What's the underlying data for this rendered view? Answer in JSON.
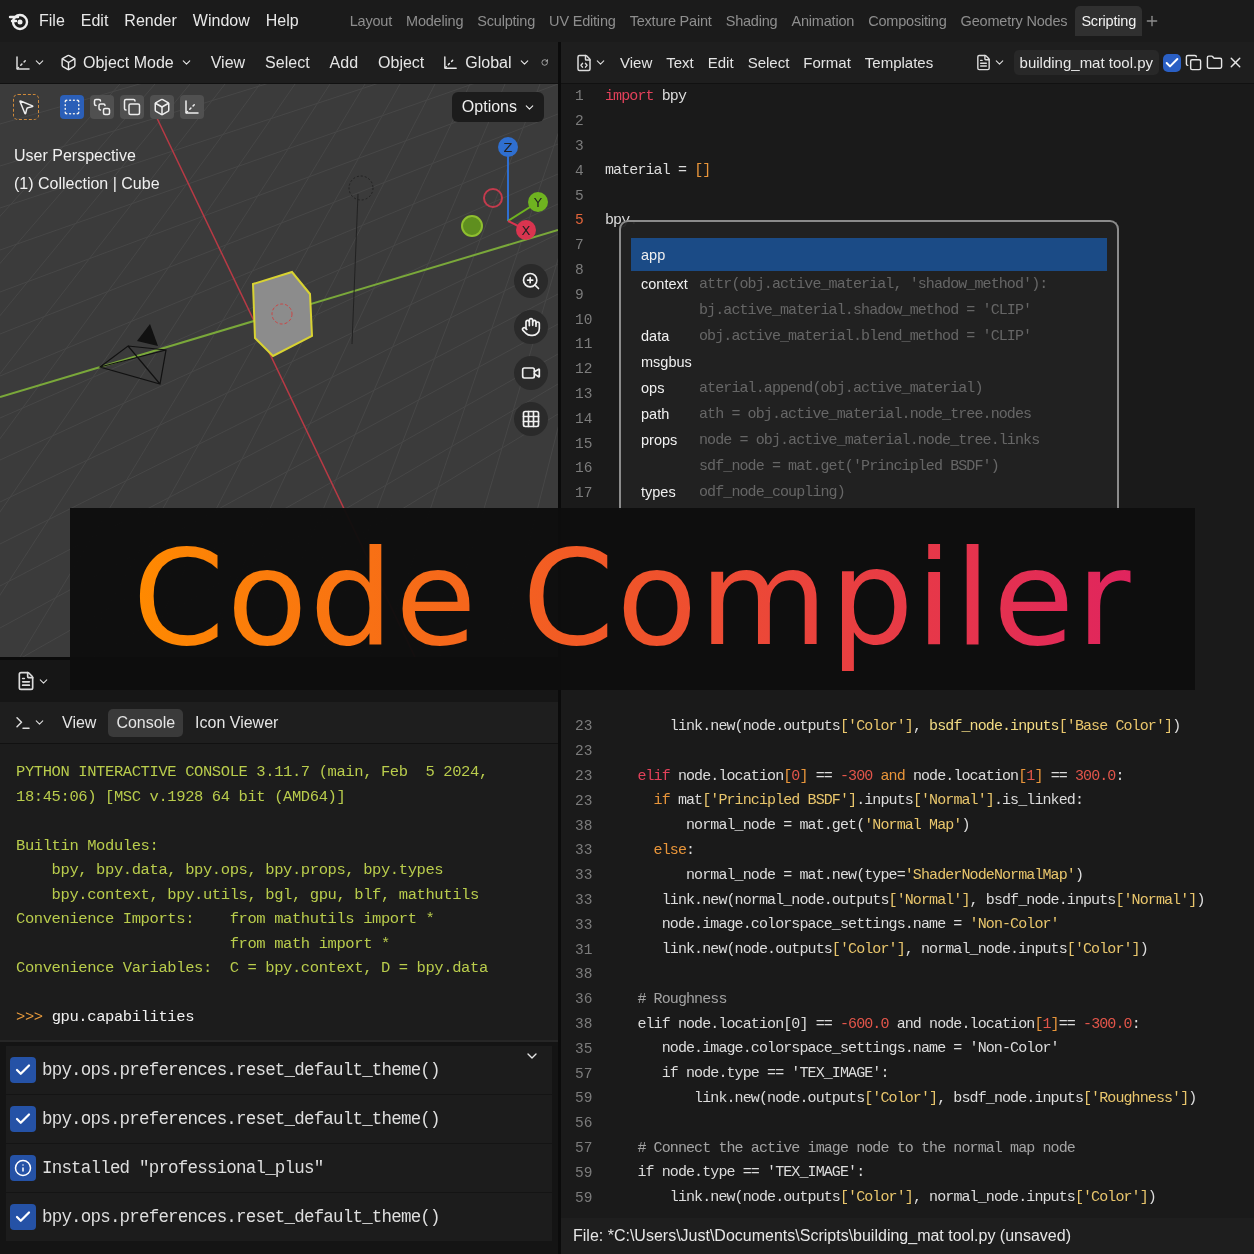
{
  "menu_bar": {
    "items": [
      "File",
      "Edit",
      "Render",
      "Window",
      "Help"
    ],
    "workspaces": [
      {
        "label": "Layout",
        "selected": false
      },
      {
        "label": "Modeling",
        "selected": false
      },
      {
        "label": "Sculpting",
        "selected": false
      },
      {
        "label": "UV Editing",
        "selected": false
      },
      {
        "label": "Texture Paint",
        "selected": false
      },
      {
        "label": "Shading",
        "selected": false
      },
      {
        "label": "Animation",
        "selected": false
      },
      {
        "label": "Compositing",
        "selected": false
      },
      {
        "label": "Geometry Nodes",
        "selected": false
      },
      {
        "label": "Scripting",
        "selected": true
      }
    ]
  },
  "viewport": {
    "mode": "Object Mode",
    "menus": [
      "View",
      "Select",
      "Add",
      "Object"
    ],
    "orientation": "Global",
    "options": "Options",
    "select_modes": [
      {
        "selected": true
      },
      {
        "selected": false
      },
      {
        "selected": false
      },
      {
        "selected": false
      },
      {
        "selected": false
      }
    ],
    "overlay_lines": [
      "User Perspective",
      "(1) Collection | Cube"
    ],
    "gizmo_axes": [
      {
        "label": "Z",
        "color": "#2f6fd0"
      },
      {
        "label": "Y",
        "color": "#6fb320"
      },
      {
        "label": "X",
        "color": "#d9344f"
      }
    ]
  },
  "console": {
    "menus": [
      {
        "label": "View",
        "selected": false
      },
      {
        "label": "Console",
        "selected": true
      },
      {
        "label": "Icon Viewer",
        "selected": false
      }
    ],
    "output_blocks": [
      [
        "PYTHON INTERACTIVE CONSOLE 3.11.7 (main, Feb  5 2024,",
        "18:45:06) [MSC v.1928 64 bit (AMD64)]"
      ],
      [
        "Builtin Modules:",
        "    bpy, bpy.data, bpy.ops, bpy.props, bpy.types",
        "    bpy.context, bpy.utils, bgl, gpu, blf, mathutils",
        "Convenience Imports:    from mathutils import *",
        "                        from math import *",
        "Convenience Variables:  C = bpy.context, D = bpy.data"
      ]
    ],
    "prompt": {
      "symbol": ">>>",
      "command": "gpu.capabilities"
    },
    "info_log": [
      {
        "kind": "check",
        "text": "bpy.ops.preferences.reset_default_theme()"
      },
      {
        "kind": "check",
        "text": "bpy.ops.preferences.reset_default_theme()"
      },
      {
        "kind": "info",
        "text": "Installed \"professional_plus\""
      },
      {
        "kind": "check",
        "text": "bpy.ops.preferences.reset_default_theme()"
      }
    ]
  },
  "text_editor": {
    "menus": [
      "View",
      "Text",
      "Edit",
      "Select",
      "Format",
      "Templates"
    ],
    "filename": "building_mat tool.py",
    "registered": true,
    "top_lines": [
      {
        "num": "1",
        "current": false,
        "tokens": [
          {
            "text": "import",
            "kind": "special"
          },
          {
            "text": " bpy",
            "kind": "plain"
          }
        ]
      },
      {
        "num": "2",
        "current": false
      },
      {
        "num": "3",
        "current": false
      },
      {
        "num": "4",
        "current": false,
        "tokens": [
          {
            "text": "material = ",
            "kind": "plain"
          },
          {
            "text": "[]",
            "kind": "bracket"
          }
        ]
      },
      {
        "num": "5",
        "current": false
      },
      {
        "num": "5",
        "current": true,
        "tokens": [
          {
            "text": "bpy.",
            "kind": "plain"
          }
        ]
      },
      {
        "num": "7",
        "current": false
      },
      {
        "num": "8",
        "current": false
      },
      {
        "num": "9",
        "current": false
      },
      {
        "num": "10",
        "current": false
      },
      {
        "num": "11",
        "current": false
      },
      {
        "num": "12",
        "current": false
      },
      {
        "num": "13",
        "current": false
      },
      {
        "num": "14",
        "current": false
      },
      {
        "num": "15",
        "current": false
      },
      {
        "num": "16",
        "current": false
      },
      {
        "num": "17",
        "current": false
      }
    ],
    "autocomplete": [
      {
        "label": "app",
        "selected": true
      },
      {
        "label": "context",
        "selected": false,
        "ghost": "attr(obj.active_material, 'shadow_method'):"
      },
      {
        "ghost": "bj.active_material.shadow_method = 'CLIP'",
        "selected": false
      },
      {
        "label": "data",
        "selected": false,
        "ghost": "obj.active_material.blend_method = 'CLIP'"
      },
      {
        "label": "msgbus",
        "selected": false
      },
      {
        "label": "ops",
        "selected": false,
        "ghost": "aterial.append(obj.active_material)"
      },
      {
        "label": "path",
        "selected": false,
        "ghost": "ath = obj.active_material.node_tree.nodes"
      },
      {
        "label": "props",
        "selected": false,
        "ghost": "node = obj.active_material.node_tree.links"
      },
      {
        "ghost": "sdf_node = mat.get('Principled BSDF')",
        "selected": false
      },
      {
        "label": "types",
        "selected": false,
        "ghost": "odf_node_coupling)"
      }
    ],
    "bottom_lines": [
      {
        "num": "23",
        "current": false,
        "tokens": [
          {
            "text": "        link.new(node.outputs",
            "kind": "plain"
          },
          {
            "text": "['Color']",
            "kind": "string"
          },
          {
            "text": ", ",
            "kind": "plain"
          },
          {
            "text": "bsdf_node.inputs",
            "kind": "attr"
          },
          {
            "text": "['Base Color']",
            "kind": "string"
          },
          {
            "text": ")",
            "kind": "plain"
          }
        ]
      },
      {
        "num": "23",
        "current": false
      },
      {
        "num": "23",
        "current": false,
        "tokens": [
          {
            "text": "    elif",
            "kind": "special"
          },
          {
            "text": " node.location",
            "kind": "plain"
          },
          {
            "text": "[",
            "kind": "bracket"
          },
          {
            "text": "0",
            "kind": "number"
          },
          {
            "text": "]",
            "kind": "bracket"
          },
          {
            "text": " == ",
            "kind": "plain"
          },
          {
            "text": "-300",
            "kind": "number"
          },
          {
            "text": " and",
            "kind": "keyword"
          },
          {
            "text": " node.location",
            "kind": "plain"
          },
          {
            "text": "[",
            "kind": "bracket"
          },
          {
            "text": "1",
            "kind": "number"
          },
          {
            "text": "]",
            "kind": "bracket"
          },
          {
            "text": " == ",
            "kind": "plain"
          },
          {
            "text": "300.0",
            "kind": "number"
          },
          {
            "text": ":",
            "kind": "plain"
          }
        ]
      },
      {
        "num": "23",
        "current": false,
        "tokens": [
          {
            "text": "      if",
            "kind": "keyword"
          },
          {
            "text": " mat",
            "kind": "plain"
          },
          {
            "text": "['Principled BSDF']",
            "kind": "string"
          },
          {
            "text": ".inputs",
            "kind": "plain"
          },
          {
            "text": "['Normal']",
            "kind": "string"
          },
          {
            "text": ".is_linked:",
            "kind": "plain"
          }
        ]
      },
      {
        "num": "38",
        "current": false,
        "tokens": [
          {
            "text": "          normal_node = mat.get(",
            "kind": "plain"
          },
          {
            "text": "'Normal Map'",
            "kind": "string"
          },
          {
            "text": ")",
            "kind": "plain"
          }
        ]
      },
      {
        "num": "33",
        "current": false,
        "tokens": [
          {
            "text": "      else",
            "kind": "keyword"
          },
          {
            "text": ":",
            "kind": "plain"
          }
        ]
      },
      {
        "num": "33",
        "current": false,
        "tokens": [
          {
            "text": "          normal_node = mat.new(type=",
            "kind": "plain"
          },
          {
            "text": "'ShaderNodeNormalMap'",
            "kind": "string"
          },
          {
            "text": ")",
            "kind": "plain"
          }
        ]
      },
      {
        "num": "33",
        "current": false,
        "tokens": [
          {
            "text": "       link.new(normal_node.outputs",
            "kind": "plain"
          },
          {
            "text": "['Normal']",
            "kind": "string"
          },
          {
            "text": ", bsdf_node.inputs",
            "kind": "plain"
          },
          {
            "text": "['Normal']",
            "kind": "string"
          },
          {
            "text": ")",
            "kind": "plain"
          }
        ]
      },
      {
        "num": "33",
        "current": false,
        "tokens": [
          {
            "text": "       node.image.colorspace_settings.name = ",
            "kind": "plain"
          },
          {
            "text": "'Non-Color'",
            "kind": "string"
          }
        ]
      },
      {
        "num": "31",
        "current": false,
        "tokens": [
          {
            "text": "       link.new(node.outputs",
            "kind": "plain"
          },
          {
            "text": "['Color']",
            "kind": "string"
          },
          {
            "text": ", normal_node.inputs",
            "kind": "plain"
          },
          {
            "text": "['Color']",
            "kind": "string"
          },
          {
            "text": ")",
            "kind": "plain"
          }
        ]
      },
      {
        "num": "38",
        "current": false
      },
      {
        "num": "36",
        "current": false,
        "tokens": [
          {
            "text": "    # Roughness",
            "kind": "comment"
          }
        ]
      },
      {
        "num": "38",
        "current": false,
        "tokens": [
          {
            "text": "    elif node.location[0] == ",
            "kind": "plain"
          },
          {
            "text": "-600.0",
            "kind": "number"
          },
          {
            "text": " and node.location",
            "kind": "plain"
          },
          {
            "text": "[",
            "kind": "bracket"
          },
          {
            "text": "1",
            "kind": "number"
          },
          {
            "text": "]",
            "kind": "bracket"
          },
          {
            "text": "== ",
            "kind": "plain"
          },
          {
            "text": "-300.0",
            "kind": "number"
          },
          {
            "text": ":",
            "kind": "plain"
          }
        ]
      },
      {
        "num": "35",
        "current": false,
        "tokens": [
          {
            "text": "       node.image.colorspace_settings.name = 'Non-Color'",
            "kind": "plain"
          }
        ]
      },
      {
        "num": "57",
        "current": false,
        "tokens": [
          {
            "text": "       if node.type == 'TEX_IMAGE':",
            "kind": "plain"
          }
        ]
      },
      {
        "num": "59",
        "current": false,
        "tokens": [
          {
            "text": "           link.new(node.outputs",
            "kind": "plain"
          },
          {
            "text": "['Color']",
            "kind": "string"
          },
          {
            "text": ", bsdf_node.inputs",
            "kind": "plain"
          },
          {
            "text": "['Roughness']",
            "kind": "string"
          },
          {
            "text": ")",
            "kind": "plain"
          }
        ]
      },
      {
        "num": "56",
        "current": false
      },
      {
        "num": "57",
        "current": false,
        "tokens": [
          {
            "text": "    # Connect the active image node to the normal map node",
            "kind": "comment"
          }
        ]
      },
      {
        "num": "59",
        "current": false,
        "tokens": [
          {
            "text": "    if node.type == 'TEX_IMAGE':",
            "kind": "plain"
          }
        ]
      },
      {
        "num": "59",
        "current": false,
        "tokens": [
          {
            "text": "        link.new(node.outputs",
            "kind": "plain"
          },
          {
            "text": "['Color']",
            "kind": "string"
          },
          {
            "text": ", normal_node.inputs",
            "kind": "plain"
          },
          {
            "text": "['Color']",
            "kind": "string"
          },
          {
            "text": ")",
            "kind": "plain"
          }
        ]
      }
    ],
    "status": "File: *C:\\Users\\Just\\Documents\\Scripts\\building_mat tool.py (unsaved)"
  },
  "banner": {
    "title": "Code Compiler"
  }
}
